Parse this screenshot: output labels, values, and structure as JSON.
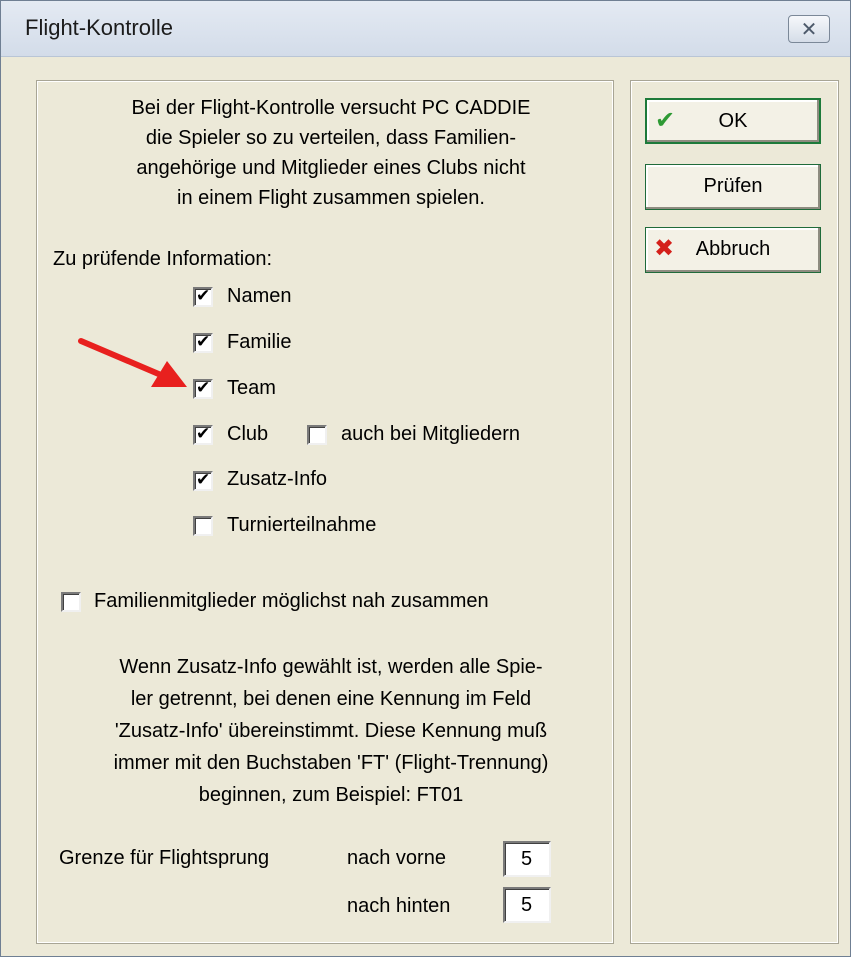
{
  "window": {
    "title": "Flight-Kontrolle",
    "close_glyph": "✕"
  },
  "intro": {
    "lines": [
      "Bei der Flight-Kontrolle versucht PC CADDIE",
      "die Spieler so zu verteilen, dass Familien-",
      "angehörige und Mitglieder eines Clubs nicht",
      "in einem Flight zusammen spielen."
    ]
  },
  "check_section": {
    "heading": "Zu prüfende Information:",
    "items": [
      {
        "label": "Namen",
        "checked": true
      },
      {
        "label": "Familie",
        "checked": true
      },
      {
        "label": "Team",
        "checked": true
      },
      {
        "label": "Club",
        "checked": true
      },
      {
        "label": "Zusatz-Info",
        "checked": true
      },
      {
        "label": "Turnierteilnahme",
        "checked": false
      }
    ],
    "club_extra": {
      "label": "auch bei Mitgliedern",
      "checked": false
    }
  },
  "family_option": {
    "label": "Familienmitglieder möglichst nah zusammen",
    "checked": false
  },
  "info": {
    "lines": [
      "Wenn Zusatz-Info gewählt ist, werden alle Spie-",
      "ler getrennt, bei denen eine Kennung im Feld",
      "'Zusatz-Info' übereinstimmt. Diese Kennung muß",
      "immer mit den Buchstaben 'FT' (Flight-Trennung)",
      "beginnen, zum Beispiel: FT01"
    ]
  },
  "limits": {
    "label": "Grenze für Flightsprung",
    "front_label": "nach vorne",
    "front_value": "5",
    "back_label": "nach hinten",
    "back_value": "5"
  },
  "buttons": {
    "ok": "OK",
    "check": "Prüfen",
    "cancel": "Abbruch"
  },
  "colors": {
    "dialog_bg": "#ece9d8",
    "ok_icon": "#2e9a34",
    "cancel_icon": "#d4201a",
    "arrow": "#e8201e"
  },
  "icons": {
    "ok": "checkmark-icon",
    "cancel": "x-icon",
    "close": "close-icon",
    "annotation": "red-arrow-icon"
  }
}
